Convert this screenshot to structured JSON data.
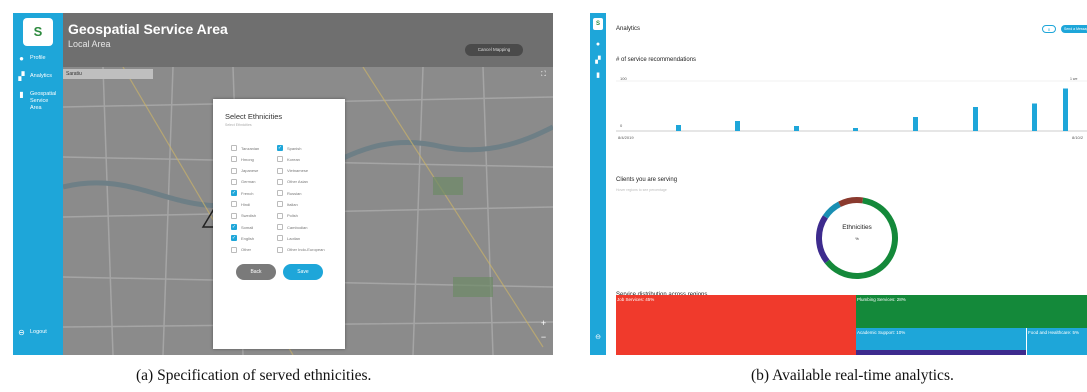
{
  "panel_a": {
    "sidebar": {
      "logo": "S",
      "items": [
        {
          "icon": "user-icon",
          "label": "Profile"
        },
        {
          "icon": "chart-icon",
          "label": "Analytics"
        },
        {
          "icon": "map-icon",
          "label": "Geospatial Service Area"
        }
      ],
      "logout": "Logout"
    },
    "title": "Geospatial Service Area",
    "subtitle": "Local Area",
    "cancel_button": "Cancel Mapping",
    "map_search": "Saratiu",
    "modal": {
      "title": "Select Ethnicities",
      "subtitle": "Select Ethnicities",
      "options_left": [
        {
          "label": "Tanzanian",
          "checked": false
        },
        {
          "label": "Hmong",
          "checked": false
        },
        {
          "label": "Japanese",
          "checked": false
        },
        {
          "label": "German",
          "checked": false
        },
        {
          "label": "French",
          "checked": true
        },
        {
          "label": "Hindi",
          "checked": false
        },
        {
          "label": "Swedish",
          "checked": false
        },
        {
          "label": "Somali",
          "checked": true
        },
        {
          "label": "English",
          "checked": true
        },
        {
          "label": "Other",
          "checked": false
        }
      ],
      "options_right": [
        {
          "label": "Spanish",
          "checked": true
        },
        {
          "label": "Korean",
          "checked": false
        },
        {
          "label": "Vietnamese",
          "checked": false
        },
        {
          "label": "Other Asian",
          "checked": false
        },
        {
          "label": "Russian",
          "checked": false
        },
        {
          "label": "Italian",
          "checked": false
        },
        {
          "label": "Polish",
          "checked": false
        },
        {
          "label": "Cambodian",
          "checked": false
        },
        {
          "label": "Laotian",
          "checked": false
        },
        {
          "label": "Other Indo-European",
          "checked": false
        }
      ],
      "back_button": "Back",
      "save_button": "Save"
    },
    "zoom_in": "+",
    "zoom_out": "−"
  },
  "panel_b": {
    "title": "Analytics",
    "pill_count": "0",
    "pill_action": "Send a Message",
    "recommendations_title": "# of service recommendations",
    "recommendations_ymax_label": "100",
    "recommendations_ymin_label": "0",
    "recommendations_start": "8/4/2019",
    "recommendations_end": "8/10/2",
    "recommendations_week": "1 we",
    "clients_title": "Clients you are serving",
    "clients_hint": "Hover regions to see percentage",
    "donut_label": "Ethnicities",
    "donut_sub": "%",
    "distribution_title": "Service distribution across regions",
    "colors": {
      "accent": "#1ea6d9",
      "green": "#14893a",
      "red": "#f03a2c",
      "purple": "#3d2b8e",
      "brown": "#8a3a2e"
    }
  },
  "chart_data": [
    {
      "type": "bar",
      "title": "# of service recommendations",
      "y_tick_labels": [
        "100",
        "0"
      ],
      "x_tick_labels": [
        "8/4/2019",
        "8/10/2"
      ],
      "values": [
        12,
        20,
        10,
        6,
        28,
        48,
        55,
        85
      ]
    },
    {
      "type": "pie",
      "title": "Clients you are serving",
      "center_label": "Ethnicities",
      "slices": [
        {
          "color": "#14893a",
          "value": 62
        },
        {
          "color": "#3d2b8e",
          "value": 20
        },
        {
          "color": "#1a8fb3",
          "value": 8
        },
        {
          "color": "#8a3a2e",
          "value": 10
        }
      ]
    },
    {
      "type": "treemap",
      "title": "Service distribution across regions",
      "items": [
        {
          "label": "Job Services: 45%",
          "value": 45,
          "color": "#f03a2c"
        },
        {
          "label": "Plumbing Services: 28%",
          "value": 28,
          "color": "#14893a"
        },
        {
          "label": "Academic Support: 10%",
          "value": 10,
          "color": "#1ea6d9"
        },
        {
          "label": "Food and Healthcare: 5%",
          "value": 5,
          "color": "#1ea6d9"
        }
      ]
    }
  ],
  "captions": {
    "a": "(a) Specification of served ethnicities.",
    "b": "(b) Available real-time analytics."
  }
}
